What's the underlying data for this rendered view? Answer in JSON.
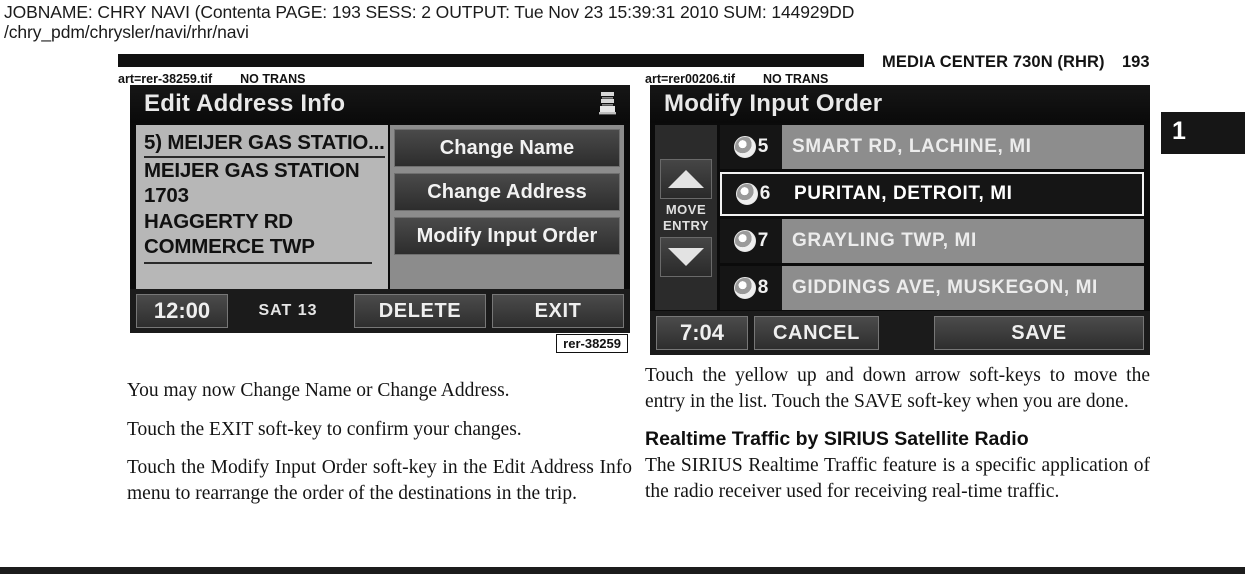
{
  "job_header": {
    "line1": "JOBNAME: CHRY NAVI (Contenta   PAGE: 193  SESS: 2  OUTPUT: Tue Nov 23 15:39:31 2010  SUM: 144929DD",
    "line2": "/chry_pdm/chrysler/navi/rhr/navi"
  },
  "running_head": {
    "title": "MEDIA CENTER 730N (RHR)",
    "page_number": "193"
  },
  "thumb_tab": {
    "label": "1"
  },
  "art_slugs": {
    "left": {
      "file": "art=rer-38259.tif",
      "trans": "NO TRANS"
    },
    "right": {
      "file": "art=rer00206.tif",
      "trans": "NO TRANS"
    }
  },
  "left_screen": {
    "title": "Edit Address Info",
    "icon": "list-stack-icon",
    "info_lines": [
      "5) MEIJER GAS STATIO...",
      "MEIJER GAS STATION",
      "1703",
      "HAGGERTY RD",
      "COMMERCE TWP"
    ],
    "soft_keys": [
      "Change Name",
      "Change Address",
      "Modify Input Order"
    ],
    "clock": "12:00",
    "day": "SAT  13",
    "bottom_keys": [
      "DELETE",
      "EXIT"
    ],
    "caption": "rer-38259"
  },
  "right_screen": {
    "title": "Modify Input Order",
    "move_label_line1": "MOVE",
    "move_label_line2": "ENTRY",
    "up_arrow": "up-arrow-icon",
    "down_arrow": "down-arrow-icon",
    "entries": [
      {
        "number": "5",
        "text": "SMART RD, LACHINE, MI",
        "selected": false
      },
      {
        "number": "6",
        "text": "PURITAN, DETROIT, MI",
        "selected": true
      },
      {
        "number": "7",
        "text": "GRAYLING TWP, MI",
        "selected": false
      },
      {
        "number": "8",
        "text": "GIDDINGS AVE, MUSKEGON, MI",
        "selected": false
      }
    ],
    "clock": "7:04",
    "cancel_label": "CANCEL",
    "save_label": "SAVE"
  },
  "body_left": {
    "p1": "You may now Change Name or Change Address.",
    "p2": "Touch the EXIT soft-key to confirm your changes.",
    "p3": "Touch the Modify Input Order soft-key in the Edit Address Info menu to rearrange the order of the destinations in the trip."
  },
  "body_right": {
    "p1": "Touch the yellow up and down arrow soft-keys to move the entry in the list. Touch the SAVE soft-key when you are done.",
    "heading": "Realtime Traffic by SIRIUS Satellite Radio",
    "p2": "The SIRIUS Realtime Traffic feature is a specific application of the radio receiver used for receiving real-time traffic."
  }
}
